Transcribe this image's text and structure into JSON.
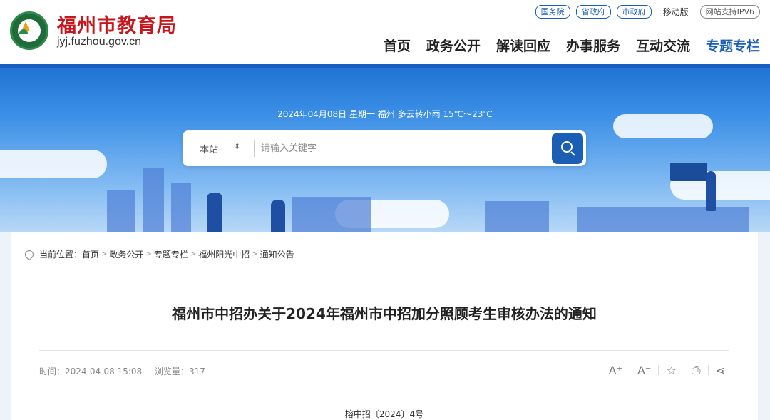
{
  "header": {
    "site_name": "福州市教育局",
    "site_domain": "jyj.fuzhou.gov.cn",
    "top_links": [
      "国务院",
      "省政府",
      "市政府"
    ],
    "mobile": "移动版",
    "ipv6": "网站支持IPV6"
  },
  "nav": {
    "items": [
      "首页",
      "政务公开",
      "解读回应",
      "办事服务",
      "互动交流",
      "专题专栏"
    ],
    "active_index": 5
  },
  "banner": {
    "weather": "2024年04月08日 星期一 福州 多云转小雨 15℃～23℃"
  },
  "search": {
    "scope": "本站",
    "placeholder": "请输入关键字"
  },
  "breadcrumb": {
    "label": "当前位置：",
    "items": [
      "首页",
      "政务公开",
      "专题专栏",
      "福州阳光中招",
      "通知公告"
    ]
  },
  "article": {
    "title": "福州市中招办关于2024年福州市中招加分照顾考生审核办法的通知",
    "time": "时间：2024-04-08 15:08",
    "views": "浏览量：317",
    "doc_number": "榕中招〔2024〕4号"
  },
  "tools": {
    "font_increase": "A⁺",
    "font_decrease": "A⁻",
    "favorite": "☆",
    "print": "⎙",
    "share": "⋖"
  },
  "colors": {
    "brand_red": "#c8161d",
    "brand_blue": "#1a5fb4"
  }
}
